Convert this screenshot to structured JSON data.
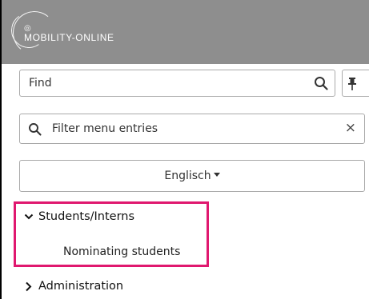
{
  "header": {
    "logo_text": "MOBILITY-ONLINE"
  },
  "find": {
    "value": "Find"
  },
  "filter": {
    "placeholder": "Filter menu entries",
    "clear_glyph": "×"
  },
  "language": {
    "label": "Englisch"
  },
  "menu": {
    "items": [
      {
        "label": "Students/Interns",
        "expanded": true,
        "children": [
          {
            "label": "Nominating students"
          }
        ]
      },
      {
        "label": "Administration",
        "expanded": false
      }
    ]
  },
  "colors": {
    "header_bg": "#8e8e8e",
    "highlight": "#e0186f"
  },
  "icons": {
    "find": "search-icon",
    "pin": "pin-icon",
    "filter": "search-icon",
    "clear": "close-icon",
    "expanded": "chevron-down-icon",
    "collapsed": "chevron-right-icon"
  }
}
